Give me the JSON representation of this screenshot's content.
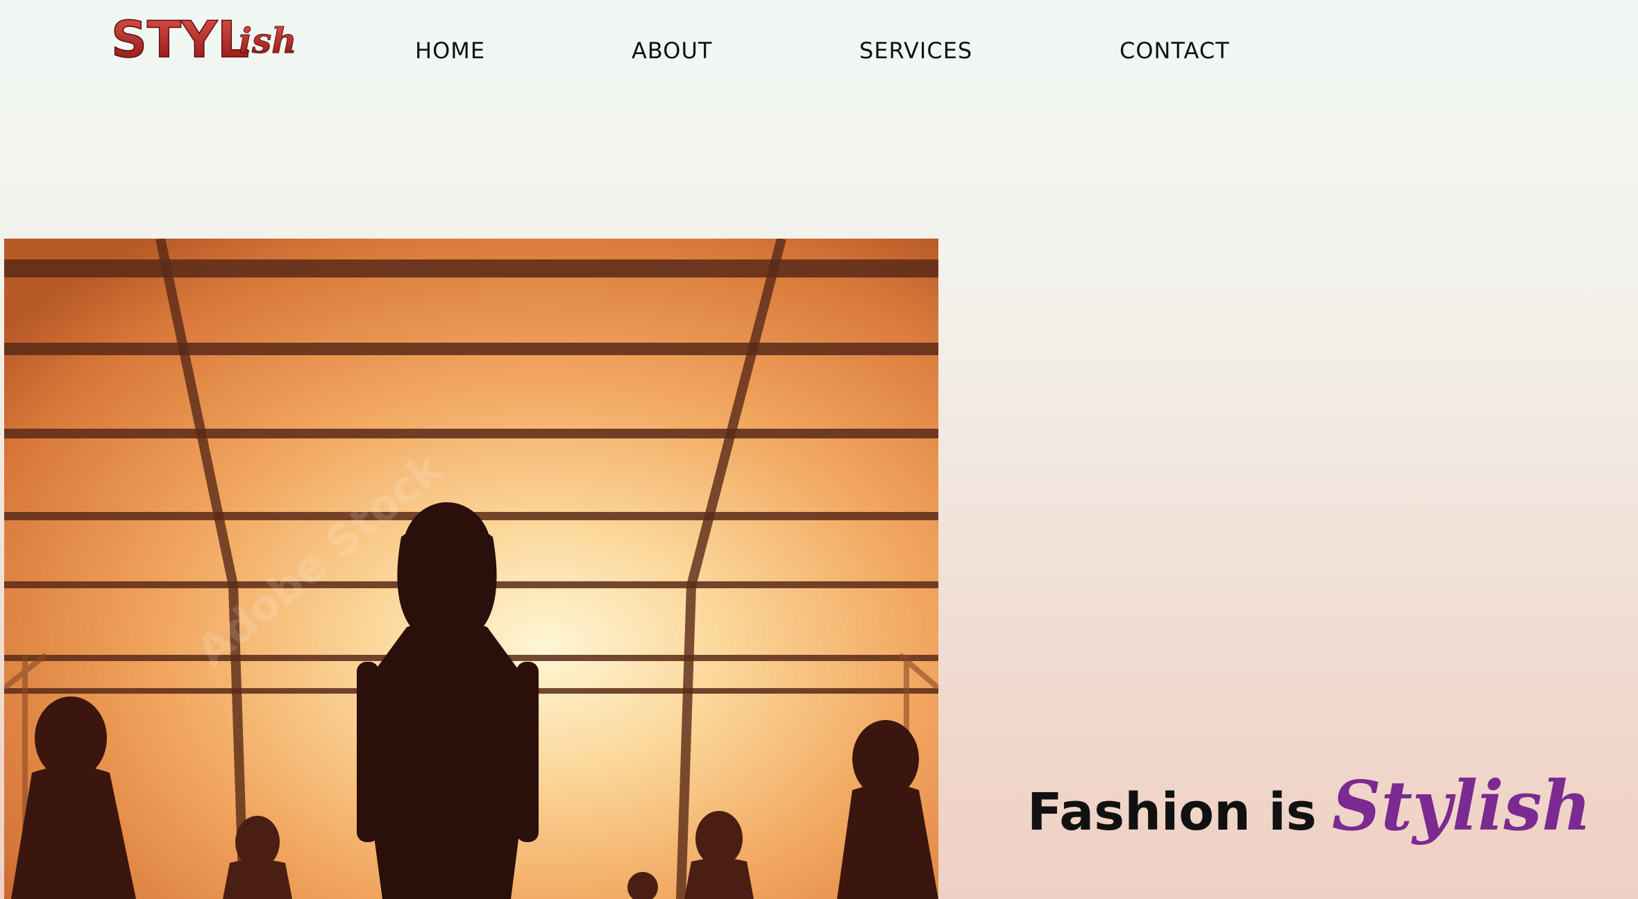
{
  "brand": {
    "logo_text_main": "STYL",
    "logo_text_script": "ish",
    "logo_color": "#b52a2a"
  },
  "nav": {
    "items": [
      {
        "label": "HOME"
      },
      {
        "label": "ABOUT"
      },
      {
        "label": "SERVICES"
      },
      {
        "label": "CONTACT"
      }
    ]
  },
  "hero": {
    "image_icon": "runway-silhouette-image",
    "watermark": "Adobe Stock",
    "tagline_main": "Fashion is",
    "tagline_accent": "Stylish",
    "accent_color": "#7a2a90"
  }
}
